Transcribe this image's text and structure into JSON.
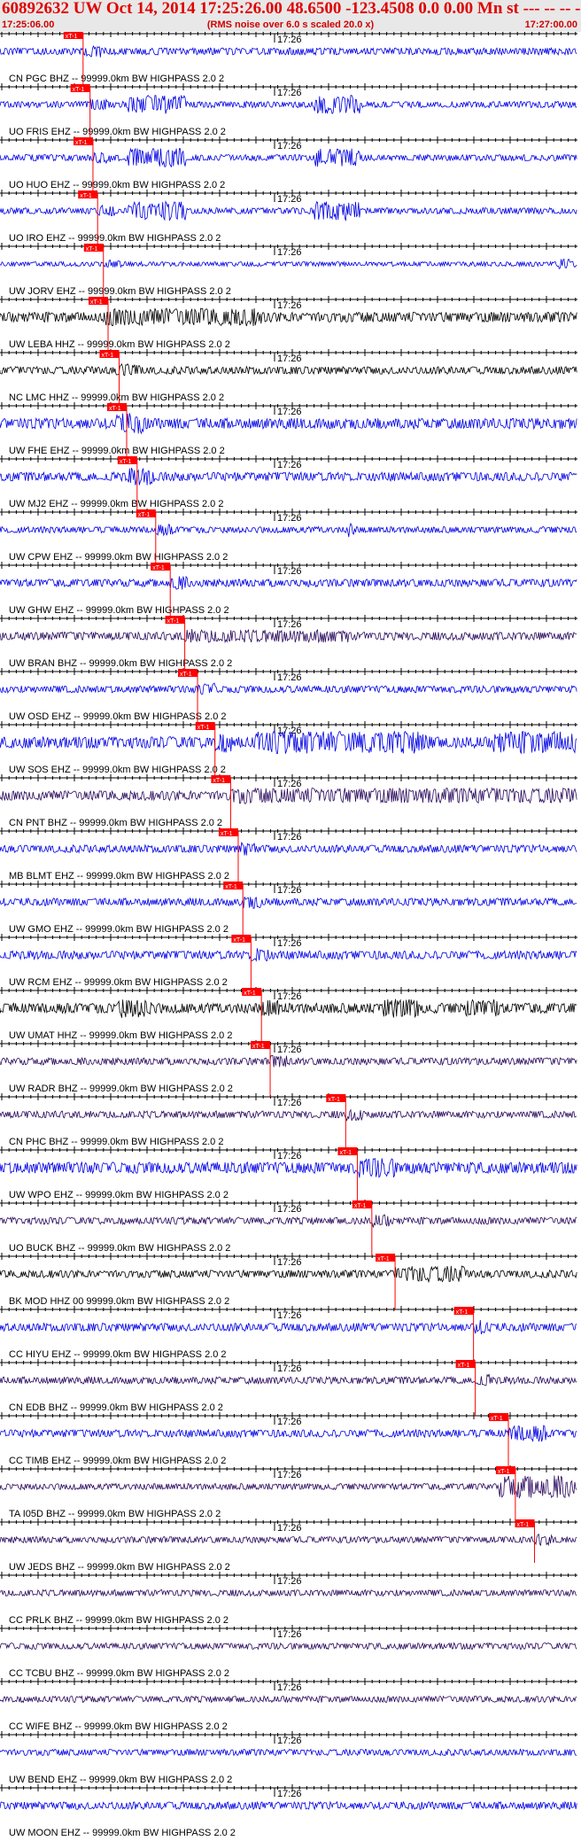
{
  "header": {
    "title": "60892632 UW Oct 14, 2014 17:25:26.00   48.6500 -123.4508  0.0 0.00 Mn st --- -- --  -1",
    "start_time": "17:25:06.00",
    "rms_note": "(RMS noise over 6.0 s scaled 20.0 x)",
    "end_time": "17:27:00.00"
  },
  "colors": {
    "trace_blue": "#0000e6",
    "trace_black": "#000000",
    "trace_purple": "#2a0a5e",
    "pick_red": "#ff0000",
    "title_red": "#e00000",
    "header_bg": "#e8e8e8"
  },
  "pick_label": "xT-1",
  "channels": [
    {
      "label": "CN PGC BHZ -- 99999.0km BW  HIGHPASS  2.0  2",
      "tick": "17:26",
      "color": "blue",
      "pick": 0.143,
      "amp": 0.28,
      "bursts": []
    },
    {
      "label": "UO FRIS EHZ -- 99999.0km BW  HIGHPASS  2.0  2",
      "tick": "17:26",
      "color": "blue",
      "pick": 0.155,
      "amp": 0.25,
      "bursts": [
        [
          0.22,
          0.32,
          3.0
        ],
        [
          0.54,
          0.62,
          3.0
        ]
      ]
    },
    {
      "label": "UO HUO EHZ -- 99999.0km BW  HIGHPASS  2.0  2",
      "tick": "17:26",
      "color": "blue",
      "pick": 0.16,
      "amp": 0.25,
      "bursts": [
        [
          0.22,
          0.32,
          3.0
        ],
        [
          0.54,
          0.62,
          3.0
        ]
      ]
    },
    {
      "label": "UO IRO EHZ -- 99999.0km BW  HIGHPASS  2.0  2",
      "tick": "17:26",
      "color": "blue",
      "pick": 0.168,
      "amp": 0.25,
      "bursts": [
        [
          0.22,
          0.32,
          3.0
        ],
        [
          0.54,
          0.62,
          3.0
        ]
      ]
    },
    {
      "label": "UW JORV EHZ -- 99999.0km BW  HIGHPASS  2.0  2",
      "tick": "17:26",
      "color": "blue",
      "pick": 0.178,
      "amp": 0.18,
      "bursts": [
        [
          0.96,
          0.99,
          2.2
        ]
      ]
    },
    {
      "label": "UW LEBA HHZ -- 99999.0km BW  HIGHPASS  2.0  2",
      "tick": "17:26",
      "color": "black",
      "pick": 0.186,
      "amp": 0.4,
      "bursts": [
        [
          0.18,
          0.45,
          1.8
        ]
      ]
    },
    {
      "label": "NC LMC HHZ -- 99999.0km BW  HIGHPASS  2.0  2",
      "tick": "17:26",
      "color": "black",
      "pick": 0.205,
      "amp": 0.3,
      "bursts": [
        [
          0.2,
          0.24,
          1.8
        ]
      ]
    },
    {
      "label": "UW FHE EHZ -- 99999.0km BW  HIGHPASS  2.0  2",
      "tick": "17:26",
      "color": "blue",
      "pick": 0.218,
      "amp": 0.42,
      "bursts": [
        [
          0.2,
          0.25,
          2.0
        ]
      ]
    },
    {
      "label": "UW MJ2 EHZ -- 99999.0km BW  HIGHPASS  2.0  2",
      "tick": "17:26",
      "color": "blue",
      "pick": 0.236,
      "amp": 0.35,
      "bursts": [
        [
          0.22,
          0.26,
          2.0
        ]
      ]
    },
    {
      "label": "UW CPW EHZ -- 99999.0km BW  HIGHPASS  2.0  2",
      "tick": "17:26",
      "color": "blue",
      "pick": 0.268,
      "amp": 0.25,
      "bursts": [
        [
          0.6,
          0.61,
          2.5
        ]
      ]
    },
    {
      "label": "UW GHW EHZ -- 99999.0km BW  HIGHPASS  2.0  2",
      "tick": "17:26",
      "color": "blue",
      "pick": 0.293,
      "amp": 0.3,
      "bursts": []
    },
    {
      "label": "UW BRAN BHZ -- 99999.0km BW  HIGHPASS  2.0  2",
      "tick": "17:26",
      "color": "purple",
      "pick": 0.318,
      "amp": 0.32,
      "bursts": [
        [
          0.34,
          0.6,
          1.6
        ]
      ]
    },
    {
      "label": "UW OSD EHZ -- 99999.0km BW  HIGHPASS  2.0  2",
      "tick": "17:26",
      "color": "blue",
      "pick": 0.34,
      "amp": 0.28,
      "bursts": []
    },
    {
      "label": "UW SOS EHZ -- 99999.0km BW  HIGHPASS  2.0  2",
      "tick": "17:26",
      "color": "blue",
      "pick": 0.37,
      "amp": 0.45,
      "bursts": [
        [
          0.44,
          0.74,
          2.0
        ],
        [
          0.85,
          0.99,
          2.0
        ]
      ]
    },
    {
      "label": "CN PNT BHZ -- 99999.0km BW  HIGHPASS  2.0  2",
      "tick": "17:26",
      "color": "purple",
      "pick": 0.397,
      "amp": 0.38,
      "bursts": [
        [
          0.42,
          0.99,
          1.6
        ]
      ]
    },
    {
      "label": "MB BLMT EHZ -- 99999.0km BW  HIGHPASS  2.0  2",
      "tick": "17:26",
      "color": "blue",
      "pick": 0.41,
      "amp": 0.3,
      "bursts": []
    },
    {
      "label": "UW GMO EHZ -- 99999.0km BW  HIGHPASS  2.0  2",
      "tick": "17:26",
      "color": "blue",
      "pick": 0.418,
      "amp": 0.3,
      "bursts": []
    },
    {
      "label": "UW RCM EHZ -- 99999.0km BW  HIGHPASS  2.0  2",
      "tick": "17:26",
      "color": "blue",
      "pick": 0.432,
      "amp": 0.33,
      "bursts": []
    },
    {
      "label": "UW UMAT HHZ -- 99999.0km BW  HIGHPASS  2.0  2",
      "tick": "17:26",
      "color": "black",
      "pick": 0.45,
      "amp": 0.4,
      "bursts": [
        [
          0.2,
          0.26,
          2.0
        ],
        [
          0.66,
          0.72,
          2.0
        ],
        [
          0.8,
          0.86,
          1.8
        ]
      ]
    },
    {
      "label": "UW RADR BHZ -- 99999.0km BW  HIGHPASS  2.0  2",
      "tick": "17:26",
      "color": "purple",
      "pick": 0.465,
      "amp": 0.28,
      "bursts": []
    },
    {
      "label": "CN PHC BHZ -- 99999.0km BW  HIGHPASS  2.0  2",
      "tick": "17:26",
      "color": "purple",
      "pick": 0.595,
      "amp": 0.28,
      "bursts": []
    },
    {
      "label": "UW WPO EHZ -- 99999.0km BW  HIGHPASS  2.0  2",
      "tick": "17:26",
      "color": "blue",
      "pick": 0.615,
      "amp": 0.45,
      "bursts": [
        [
          0.62,
          0.68,
          1.8
        ]
      ]
    },
    {
      "label": "UO BUCK BHZ -- 99999.0km BW  HIGHPASS  2.0  2",
      "tick": "17:26",
      "color": "purple",
      "pick": 0.64,
      "amp": 0.28,
      "bursts": []
    },
    {
      "label": "BK MOD HHZ 00 99999.0km BW  HIGHPASS  2.0  2",
      "tick": "17:26",
      "color": "black",
      "pick": 0.68,
      "amp": 0.3,
      "bursts": [
        [
          0.7,
          0.8,
          2.2
        ]
      ]
    },
    {
      "label": "CC HIYU EHZ -- 99999.0km BW  HIGHPASS  2.0  2",
      "tick": "17:26",
      "color": "blue",
      "pick": 0.815,
      "amp": 0.32,
      "bursts": []
    },
    {
      "label": "CN EDB BHZ -- 99999.0km BW  HIGHPASS  2.0  2",
      "tick": "17:26",
      "color": "purple",
      "pick": 0.818,
      "amp": 0.28,
      "bursts": []
    },
    {
      "label": "CC TIMB EHZ -- 99999.0km BW  HIGHPASS  2.0  2",
      "tick": "17:26",
      "color": "blue",
      "pick": 0.875,
      "amp": 0.3,
      "bursts": [
        [
          0.88,
          0.94,
          2.2
        ]
      ]
    },
    {
      "label": "TA I05D BHZ -- 99999.0km BW  HIGHPASS  2.0  2",
      "tick": "17:26",
      "color": "purple",
      "pick": 0.887,
      "amp": 0.25,
      "bursts": [
        [
          0.86,
          0.99,
          3.6
        ]
      ]
    },
    {
      "label": "UW JEDS BHZ -- 99999.0km BW  HIGHPASS  2.0  2",
      "tick": "17:26",
      "color": "purple",
      "pick": 0.92,
      "amp": 0.25,
      "bursts": []
    },
    {
      "label": "CC PRLK BHZ -- 99999.0km BW  HIGHPASS  2.0  2",
      "tick": "17:26",
      "color": "purple",
      "pick": null,
      "amp": 0.25,
      "bursts": []
    },
    {
      "label": "CC TCBU BHZ -- 99999.0km BW  HIGHPASS  2.0  2",
      "tick": "17:26",
      "color": "purple",
      "pick": null,
      "amp": 0.25,
      "bursts": []
    },
    {
      "label": "CC WIFE BHZ -- 99999.0km BW  HIGHPASS  2.0  2",
      "tick": "17:26",
      "color": "purple",
      "pick": null,
      "amp": 0.25,
      "bursts": []
    },
    {
      "label": "UW BEND EHZ -- 99999.0km BW  HIGHPASS  2.0  2",
      "tick": "17:26",
      "color": "blue",
      "pick": null,
      "amp": 0.25,
      "bursts": []
    },
    {
      "label": "UW MOON EHZ -- 99999.0km BW  HIGHPASS  2.0  2",
      "tick": "17:26",
      "color": "blue",
      "pick": null,
      "amp": 0.3,
      "bursts": []
    }
  ]
}
